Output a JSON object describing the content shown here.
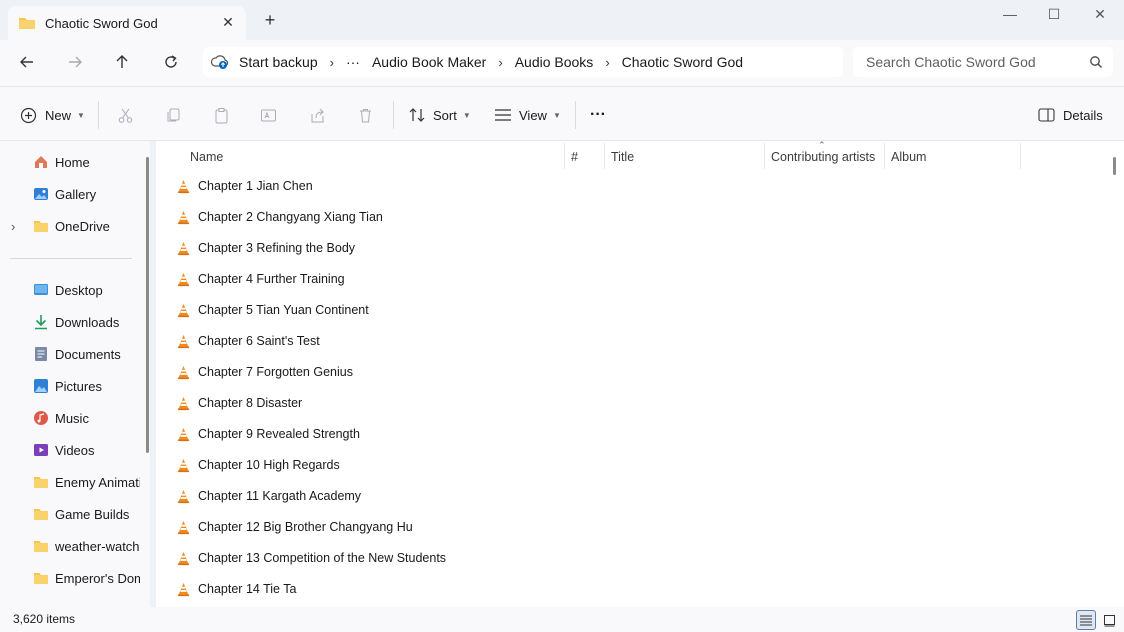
{
  "tab": {
    "title": "Chaotic Sword God"
  },
  "window": {
    "minimize": "—",
    "maximize": "☐",
    "close": "✕"
  },
  "breadcrumb": {
    "backup": "Start backup",
    "overflow": "···",
    "items": [
      "Audio Book Maker",
      "Audio Books",
      "Chaotic Sword God"
    ]
  },
  "search": {
    "placeholder": "Search Chaotic Sword God"
  },
  "commands": {
    "new": "New",
    "sort": "Sort",
    "view": "View",
    "more": "···",
    "details": "Details"
  },
  "sidebar": {
    "top": [
      {
        "label": "Home",
        "icon": "home-icon"
      },
      {
        "label": "Gallery",
        "icon": "gallery-icon"
      },
      {
        "label": "OneDrive",
        "icon": "folder-icon"
      }
    ],
    "pinned": [
      {
        "label": "Desktop",
        "icon": "desktop-icon",
        "color": "#3c8fd8"
      },
      {
        "label": "Downloads",
        "icon": "downloads-icon",
        "color": "#1f9e5b"
      },
      {
        "label": "Documents",
        "icon": "documents-icon",
        "color": "#7a8aa6"
      },
      {
        "label": "Pictures",
        "icon": "pictures-icon",
        "color": "#2f7fd6"
      },
      {
        "label": "Music",
        "icon": "music-icon",
        "color": "#e0584a"
      },
      {
        "label": "Videos",
        "icon": "videos-icon",
        "color": "#7b3fb8"
      }
    ],
    "folders": [
      "Enemy Animatic",
      "Game Builds",
      "weather-watch",
      "Emperor's Domi"
    ]
  },
  "columns": {
    "name": "Name",
    "number": "#",
    "title": "Title",
    "artists": "Contributing artists",
    "album": "Album"
  },
  "files": [
    "Chapter 1 Jian Chen",
    "Chapter 2 Changyang Xiang Tian",
    "Chapter 3 Refining the Body",
    "Chapter 4 Further Training",
    "Chapter 5 Tian Yuan Continent",
    "Chapter 6 Saint's Test",
    "Chapter 7 Forgotten Genius",
    "Chapter 8 Disaster",
    "Chapter 9 Revealed Strength",
    "Chapter 10 High Regards",
    "Chapter 11 Kargath Academy",
    "Chapter 12 Big Brother Changyang Hu",
    "Chapter 13 Competition of the New Students",
    "Chapter 14 Tie Ta"
  ],
  "status": {
    "count": "3,620 items"
  },
  "colors": {
    "folder": "#f5c451",
    "vlc_orange": "#f08a1c",
    "accent": "#0067c0"
  }
}
